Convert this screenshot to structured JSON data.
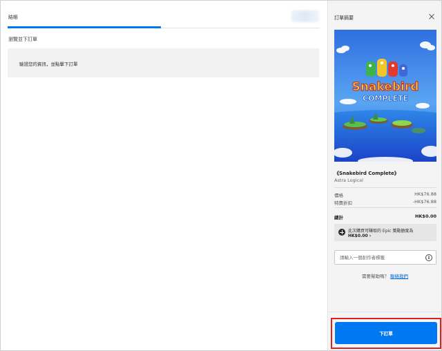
{
  "left": {
    "tab_label": "結帳",
    "subtitle": "瀏覽並下訂單",
    "info_text": "驗證您的資訊，並點擊下訂單"
  },
  "summary": {
    "title": "訂單摘要",
    "close_icon": "close-icon",
    "cover_logo_line1": "Snakebird",
    "cover_logo_line2": "COMPLETE",
    "game_title": "《Snakebird Complete》",
    "publisher": "Astra Logical",
    "price_label": "價格",
    "price_value": "HK$76.88",
    "discount_label": "特賣折扣",
    "discount_value": "-HK$76.88",
    "total_label": "總計",
    "total_value": "HK$0.00",
    "reward_line1": "此次購買可賺取的 Epic 獎勵額度為",
    "reward_line2": "HK$0.00 ›",
    "creator_placeholder": "請輸入一個創作者標籤",
    "info_icon": "i",
    "help_text": "需要幫助嗎？",
    "contact_link": "聯絡我們",
    "place_order_label": "下訂單"
  },
  "colors": {
    "accent": "#0078f2",
    "highlight_border": "#e02020",
    "panel_bg": "#f4f4f4",
    "info_box_bg": "#f2f2f2"
  }
}
